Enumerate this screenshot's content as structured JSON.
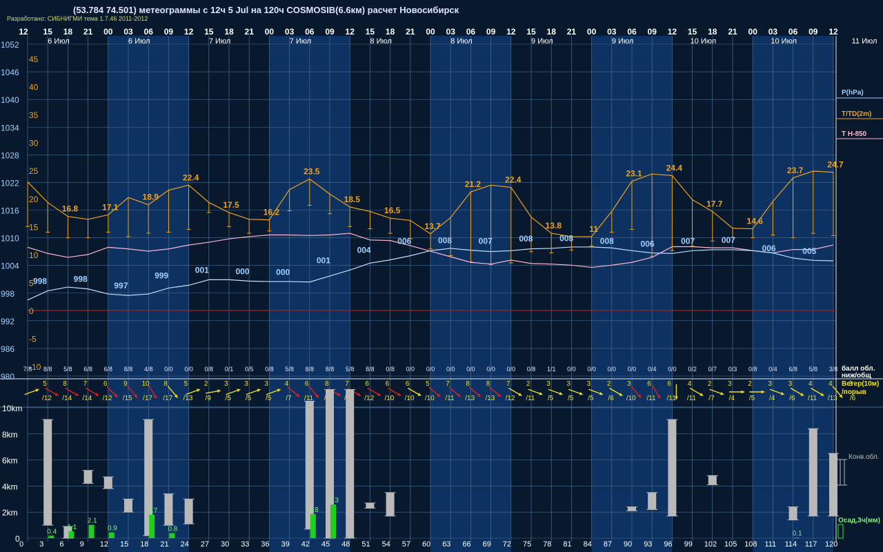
{
  "header": {
    "title": "(53.784 74.501) метеограммы с  12ч 5 Jul на 120ч COSMOSIB(6.6км) расчет Новосибирск",
    "credit": "Разработано: СИБНИГМИ тема 1.7.46 2011-2012"
  },
  "colors": {
    "background": "#08192e",
    "band": "#0d3261",
    "grid": "#4b6d92",
    "pressure": "#bfe0ff",
    "pressure_label": "#9fcfff",
    "temperature": "#f0a218",
    "t850": "#ffb6d2",
    "zero_line": "#9a2424",
    "precip": "#1ecf1e",
    "precip_label": "#7ff07f",
    "cloud_bar": "#b9b9b9",
    "wind_arrow": "#f0e020",
    "wind_arrow_strong": "#e02020",
    "wind_text": "#f0e020",
    "cloud_text": "#dfe6ff"
  },
  "time_axis": {
    "top_hours": [
      "12",
      "15",
      "18",
      "21",
      "00",
      "03",
      "06",
      "09",
      "12",
      "15",
      "18",
      "21",
      "00",
      "03",
      "06",
      "09",
      "12",
      "15",
      "18",
      "21",
      "00",
      "03",
      "06",
      "09",
      "12",
      "15",
      "18",
      "21",
      "00",
      "03",
      "06",
      "09",
      "12",
      "15",
      "18",
      "21",
      "00",
      "03",
      "06",
      "09",
      "12"
    ],
    "lead_hours": [
      "0",
      "3",
      "6",
      "9",
      "12",
      "15",
      "18",
      "21",
      "24",
      "27",
      "30",
      "33",
      "36",
      "39",
      "42",
      "45",
      "48",
      "51",
      "54",
      "57",
      "60",
      "63",
      "66",
      "69",
      "72",
      "75",
      "78",
      "81",
      "84",
      "87",
      "90",
      "93",
      "96",
      "99",
      "102",
      "105",
      "108",
      "111",
      "114",
      "117",
      "120"
    ],
    "day_labels": [
      "6 Июл",
      "6 Июл",
      "7 Июл",
      "7 Июл",
      "8 Июл",
      "8 Июл",
      "9 Июл",
      "9 Июл",
      "10 Июл",
      "10 Июл",
      "11 Июл"
    ]
  },
  "right_legend": {
    "pressure": "P(hPa)",
    "temperature": "T/TD(2m)",
    "t850": "T H-850",
    "clouds": "балл обл.",
    "clouds_sub": "ниж/общ",
    "wind": "Ветер(10м)",
    "wind_sub": "/порыв",
    "conv": "Конв.обл.",
    "precip": "Осад,3ч(мм)"
  },
  "chart_data": {
    "type": "line",
    "x": [
      0,
      3,
      6,
      9,
      12,
      15,
      18,
      21,
      24,
      27,
      30,
      33,
      36,
      39,
      42,
      45,
      48,
      51,
      54,
      57,
      60,
      63,
      66,
      69,
      72,
      75,
      78,
      81,
      84,
      87,
      90,
      93,
      96,
      99,
      102,
      105,
      108,
      111,
      114,
      117,
      120
    ],
    "y_axis_pressure": {
      "label": "",
      "ticks": [
        "1052",
        "1046",
        "1040",
        "1034",
        "1028",
        "1022",
        "1016",
        "1010",
        "1004",
        "998",
        "992",
        "986",
        "980"
      ],
      "ylim": [
        980,
        1052
      ]
    },
    "y_axis_temperature": {
      "ticks": [
        "45",
        "40",
        "35",
        "30",
        "25",
        "20",
        "15",
        "10",
        "5",
        "0",
        "-5",
        "-10"
      ],
      "ylim": [
        -12,
        48
      ]
    },
    "y_axis_height": {
      "ticks": [
        "10km",
        "8km",
        "6km",
        "4km",
        "2km",
        "0"
      ]
    },
    "series": [
      {
        "name": "P(hPa)",
        "values": [
          996.5,
          998.5,
          999.3,
          998.9,
          997.8,
          997.5,
          997.8,
          999.1,
          999.7,
          1000.9,
          1000.9,
          1000.6,
          1000.5,
          1000.5,
          1000.4,
          1001.7,
          1003,
          1004.5,
          1005.2,
          1006.1,
          1007.2,
          1007.7,
          1007.3,
          1007,
          1007.2,
          1007.6,
          1007.7,
          1008,
          1008,
          1007.8,
          1007.2,
          1006.7,
          1006.6,
          1007.2,
          1007.4,
          1007.4,
          1007.2,
          1006.7,
          1005.6,
          1005.1,
          1005
        ],
        "labels": [
          {
            "x": 3,
            "text": "998"
          },
          {
            "x": 12,
            "text": "998"
          },
          {
            "x": 21,
            "text": "997"
          },
          {
            "x": 30,
            "text": "999"
          },
          {
            "x": 36,
            "text": "001"
          },
          {
            "x": 45,
            "text": "000"
          },
          {
            "x": 54,
            "text": "000"
          },
          {
            "x": 63,
            "text": "001"
          },
          {
            "x": 72,
            "text": "004"
          },
          {
            "x": 78,
            "text": "006"
          },
          {
            "x": 87,
            "text": "008"
          },
          {
            "x": 96,
            "text": "007"
          },
          {
            "x": 105,
            "text": "008"
          },
          {
            "x": 114,
            "text": "008"
          },
          {
            "x": 120,
            "text": "008"
          },
          {
            "x": 126,
            "text": "006"
          },
          {
            "x": 132,
            "text": "007"
          },
          {
            "x": 141,
            "text": "007"
          },
          {
            "x": 150,
            "text": "006"
          },
          {
            "x": 159,
            "text": "005"
          }
        ]
      },
      {
        "name": "T/TD(2m)",
        "values": [
          23,
          19.3,
          16.8,
          16.3,
          17.1,
          20.2,
          18.9,
          21.5,
          22.4,
          19.3,
          17.5,
          16.3,
          16.2,
          21.6,
          23.5,
          20.8,
          18.5,
          17.7,
          16.5,
          16.1,
          13.7,
          16.6,
          21.2,
          22.4,
          22,
          16.7,
          13.8,
          13.2,
          13.2,
          17.7,
          23.1,
          24.4,
          24.1,
          19.8,
          17.7,
          14.7,
          14.6,
          19.5,
          23.7,
          24.9,
          24.7
        ],
        "labels": [
          {
            "x": 6,
            "text": "16.8"
          },
          {
            "x": 12,
            "text": "17.1"
          },
          {
            "x": 18,
            "text": "18.9"
          },
          {
            "x": 24,
            "text": "22.4"
          },
          {
            "x": 30,
            "text": "17.5"
          },
          {
            "x": 36,
            "text": "16.2"
          },
          {
            "x": 42,
            "text": "23.5"
          },
          {
            "x": 48,
            "text": "18.5"
          },
          {
            "x": 54,
            "text": "16.5"
          },
          {
            "x": 60,
            "text": "13.7"
          },
          {
            "x": 66,
            "text": "21.2"
          },
          {
            "x": 72,
            "text": "22.4"
          },
          {
            "x": 78,
            "text": "13.8"
          },
          {
            "x": 84,
            "text": "11"
          },
          {
            "x": 90,
            "text": "23.1"
          },
          {
            "x": 96,
            "text": "24.4"
          },
          {
            "x": 102,
            "text": "17.7"
          },
          {
            "x": 108,
            "text": "14.6"
          },
          {
            "x": 114,
            "text": "23.7"
          },
          {
            "x": 120,
            "text": "24.7"
          }
        ]
      },
      {
        "name": "TD(2m)",
        "values": [
          15,
          14,
          13,
          13,
          14,
          13.2,
          13.8,
          14,
          14.5,
          17.5,
          15,
          13.8,
          14.2,
          17.8,
          18.8,
          17.3,
          15,
          14.6,
          13.8,
          12.8,
          11,
          9.8,
          8.7,
          8.2,
          8.5,
          10.5,
          10.3,
          10.8,
          11.5,
          14,
          14.5,
          9.7,
          10.7,
          11.5,
          12.4,
          13,
          13,
          13.5,
          13,
          13.8,
          13.4
        ]
      },
      {
        "name": "T H-850",
        "values": [
          11.3,
          10.2,
          9.5,
          10,
          11.3,
          11,
          10.6,
          11,
          11.7,
          12.2,
          12.8,
          13.2,
          13.5,
          13.5,
          13.4,
          13.5,
          13.8,
          12.6,
          12.5,
          11.6,
          10.6,
          9.6,
          8.6,
          8.3,
          9,
          8.4,
          8.3,
          8.1,
          7.7,
          8.1,
          8.6,
          9.5,
          11.4,
          11.4,
          11.2,
          11.2,
          10.7,
          10.3,
          10.9,
          10.9,
          11.7
        ]
      }
    ],
    "clouds": [
      "7/8",
      "8/8",
      "5/8",
      "6/8",
      "6/8",
      "8/8",
      "4/8",
      "0/0",
      "0/0",
      "0/8",
      "0/1",
      "0/5",
      "0/8",
      "5/8",
      "8/8",
      "8/8",
      "5/8",
      "8/8",
      "0/8",
      "0/0",
      "0/0",
      "0/0",
      "0/0",
      "0/0",
      "0/0",
      "0/8",
      "1/1",
      "0/0",
      "0/0",
      "0/0",
      "0/0",
      "0/4",
      "0/0",
      "0/2",
      "0/7",
      "0/3",
      "0/8",
      "0/4",
      "6/8",
      "5/8",
      "3/8"
    ],
    "wind": [
      {
        "speed": "5",
        "gust": "/12",
        "dir": 250
      },
      {
        "speed": "8",
        "gust": "/14",
        "dir": 300
      },
      {
        "speed": "7",
        "gust": "/14",
        "dir": 300
      },
      {
        "speed": "6",
        "gust": "/12",
        "dir": 300
      },
      {
        "speed": "9",
        "gust": "/15",
        "dir": 315
      },
      {
        "speed": "10",
        "gust": "/17",
        "dir": 320
      },
      {
        "speed": "8",
        "gust": "/17",
        "dir": 330
      },
      {
        "speed": "5",
        "gust": "/13",
        "dir": 320
      },
      {
        "speed": "2",
        "gust": "/9",
        "dir": 250
      },
      {
        "speed": "3",
        "gust": "/5",
        "dir": 260
      },
      {
        "speed": "3",
        "gust": "/5",
        "dir": 250
      },
      {
        "speed": "3",
        "gust": "/5",
        "dir": 250
      },
      {
        "speed": "4",
        "gust": "/7",
        "dir": 250
      },
      {
        "speed": "6",
        "gust": "/11",
        "dir": 310
      },
      {
        "speed": "8",
        "gust": "/14",
        "dir": 320
      },
      {
        "speed": "7",
        "gust": "/14",
        "dir": 300
      },
      {
        "speed": "6",
        "gust": "/12",
        "dir": 300
      },
      {
        "speed": "6",
        "gust": "/10",
        "dir": 300
      },
      {
        "speed": "6",
        "gust": "/10",
        "dir": 300
      },
      {
        "speed": "5",
        "gust": "/10",
        "dir": 300
      },
      {
        "speed": "7",
        "gust": "/11",
        "dir": 310
      },
      {
        "speed": "8",
        "gust": "/13",
        "dir": 310
      },
      {
        "speed": "8",
        "gust": "/13",
        "dir": 310
      },
      {
        "speed": "7",
        "gust": "/12",
        "dir": 310
      },
      {
        "speed": "2",
        "gust": "/11",
        "dir": 300
      },
      {
        "speed": "3",
        "gust": "/5",
        "dir": 290
      },
      {
        "speed": "3",
        "gust": "/5",
        "dir": 290
      },
      {
        "speed": "3",
        "gust": "/5",
        "dir": 290
      },
      {
        "speed": "2",
        "gust": "/6",
        "dir": 290
      },
      {
        "speed": "3",
        "gust": "/10",
        "dir": 300
      },
      {
        "speed": "6",
        "gust": "/11",
        "dir": 320
      },
      {
        "speed": "6",
        "gust": "/11",
        "dir": 330
      },
      {
        "speed": "4",
        "gust": "/11",
        "dir": 0
      },
      {
        "speed": "2",
        "gust": "/7",
        "dir": 300
      },
      {
        "speed": "3",
        "gust": "/4",
        "dir": 290
      },
      {
        "speed": "2",
        "gust": "/5",
        "dir": 270
      },
      {
        "speed": "3",
        "gust": "/4",
        "dir": 270
      },
      {
        "speed": "3",
        "gust": "/6",
        "dir": 290
      },
      {
        "speed": "4",
        "gust": "/11",
        "dir": 300
      },
      {
        "speed": "4",
        "gust": "/13",
        "dir": 300
      },
      {
        "speed": "3",
        "gust": "/6",
        "dir": 320
      }
    ],
    "convective_clouds_km": [
      {
        "h": 3,
        "base": 1,
        "top": 9.1
      },
      {
        "h": 6,
        "base": 0,
        "top": 0.9
      },
      {
        "h": 9,
        "base": 4.2,
        "top": 5.2
      },
      {
        "h": 12,
        "base": 3.8,
        "top": 4.7
      },
      {
        "h": 15,
        "base": 2.0,
        "top": 3.0
      },
      {
        "h": 18,
        "base": 0.2,
        "top": 9.1
      },
      {
        "h": 21,
        "base": 1,
        "top": 3.4
      },
      {
        "h": 24,
        "base": 1.1,
        "top": 3.0
      },
      {
        "h": 42,
        "base": 0.7,
        "top": 10.5
      },
      {
        "h": 45,
        "base": 0,
        "top": 11.4
      },
      {
        "h": 48,
        "base": 0,
        "top": 11.4
      },
      {
        "h": 51,
        "base": 2.3,
        "top": 2.7
      },
      {
        "h": 54,
        "base": 1.7,
        "top": 3.5
      },
      {
        "h": 90,
        "base": 2.1,
        "top": 2.4
      },
      {
        "h": 93,
        "base": 2.2,
        "top": 3.5
      },
      {
        "h": 96,
        "base": 1.7,
        "top": 9.1
      },
      {
        "h": 102,
        "base": 4.1,
        "top": 4.8
      },
      {
        "h": 114,
        "base": 1.4,
        "top": 2.4
      },
      {
        "h": 117,
        "base": 1.7,
        "top": 8.4
      },
      {
        "h": 120,
        "base": 1.7,
        "top": 6.5
      }
    ],
    "precip_3h_mm": [
      {
        "h": 3,
        "v": 0.4
      },
      {
        "h": 6,
        "v": 1.1
      },
      {
        "h": 9,
        "v": 2.1
      },
      {
        "h": 12,
        "v": 0.9
      },
      {
        "h": 18,
        "v": 3.7
      },
      {
        "h": 21,
        "v": 0.8
      },
      {
        "h": 42,
        "v": 3.8
      },
      {
        "h": 45,
        "v": 5.3
      },
      {
        "h": 114,
        "v": 0.1
      }
    ]
  }
}
